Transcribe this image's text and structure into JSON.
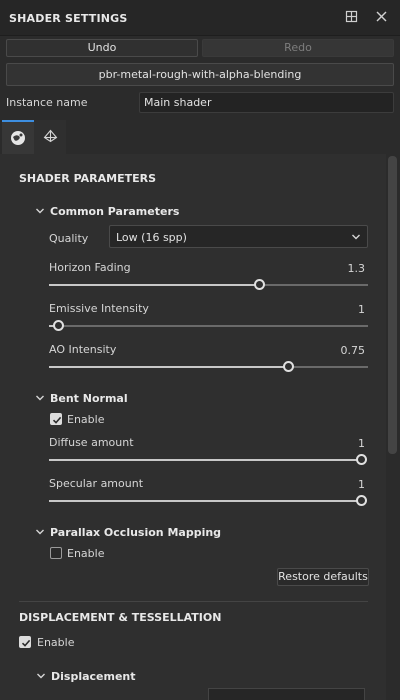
{
  "window": {
    "title": "SHADER SETTINGS",
    "icons": [
      "layout-icon",
      "close-icon"
    ]
  },
  "toolbar": {
    "undo_label": "Undo",
    "redo_label": "Redo"
  },
  "shader": {
    "name": "pbr-metal-rough-with-alpha-blending",
    "instance_label": "Instance name",
    "instance_value": "Main shader"
  },
  "tabs": [
    {
      "icon": "shader-sphere-icon",
      "active": true
    },
    {
      "icon": "displacement-icon",
      "active": false
    }
  ],
  "shader_parameters": {
    "title": "SHADER PARAMETERS",
    "common": {
      "title": "Common Parameters",
      "quality_label": "Quality",
      "quality_value": "Low (16 spp)",
      "horizon_fading": {
        "label": "Horizon Fading",
        "value": "1.3",
        "fraction": 0.66
      },
      "emissive_intensity": {
        "label": "Emissive Intensity",
        "value": "1",
        "fraction": 0.03
      },
      "ao_intensity": {
        "label": "AO Intensity",
        "value": "0.75",
        "fraction": 0.75
      }
    },
    "bent_normal": {
      "title": "Bent Normal",
      "enable_label": "Enable",
      "enabled": true,
      "diffuse": {
        "label": "Diffuse amount",
        "value": "1",
        "fraction": 1.0
      },
      "specular": {
        "label": "Specular amount",
        "value": "1",
        "fraction": 1.0
      }
    },
    "parallax": {
      "title": "Parallax Occlusion Mapping",
      "enable_label": "Enable",
      "enabled": false
    },
    "restore_label": "Restore defaults"
  },
  "displacement_tessellation": {
    "title": "DISPLACEMENT & TESSELLATION",
    "enable_label": "Enable",
    "enabled": true,
    "displacement_title": "Displacement"
  },
  "colors": {
    "accent": "#3d8ee0",
    "panel_bg": "#2f2f2f",
    "header_bg": "#262626"
  }
}
